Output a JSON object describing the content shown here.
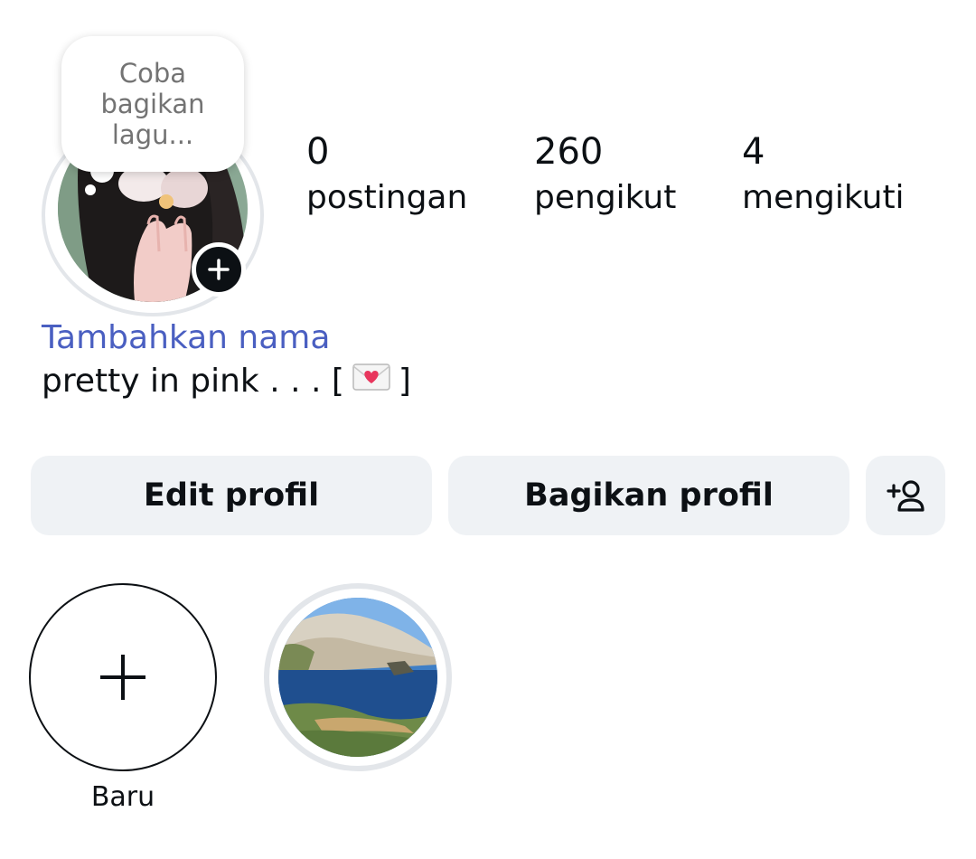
{
  "profile": {
    "note": "Coba\nbagikan\nlagu...",
    "avatar_icon": "person-photo",
    "add_story_icon": "plus-icon"
  },
  "stats": [
    {
      "value": "0",
      "label": "postingan"
    },
    {
      "value": "260",
      "label": "pengikut"
    },
    {
      "value": "4",
      "label": "mengikuti"
    }
  ],
  "name_link": "Tambahkan nama",
  "bio": {
    "before": "pretty in pink . . . [",
    "emoji": "envelope-with-heart",
    "after": "]"
  },
  "buttons": {
    "edit": "Edit profil",
    "share": "Bagikan profil",
    "add_user_icon": "add-person-icon"
  },
  "highlights": {
    "new_label": "Baru",
    "new_icon": "plus-icon",
    "items": [
      {
        "label": "",
        "icon": "coastal-landscape-photo"
      }
    ]
  },
  "colors": {
    "link": "#4a5fc1",
    "button_bg": "#eff2f5",
    "ring": "#e3e6ea",
    "text": "#0c1014",
    "note_text": "#737373"
  }
}
